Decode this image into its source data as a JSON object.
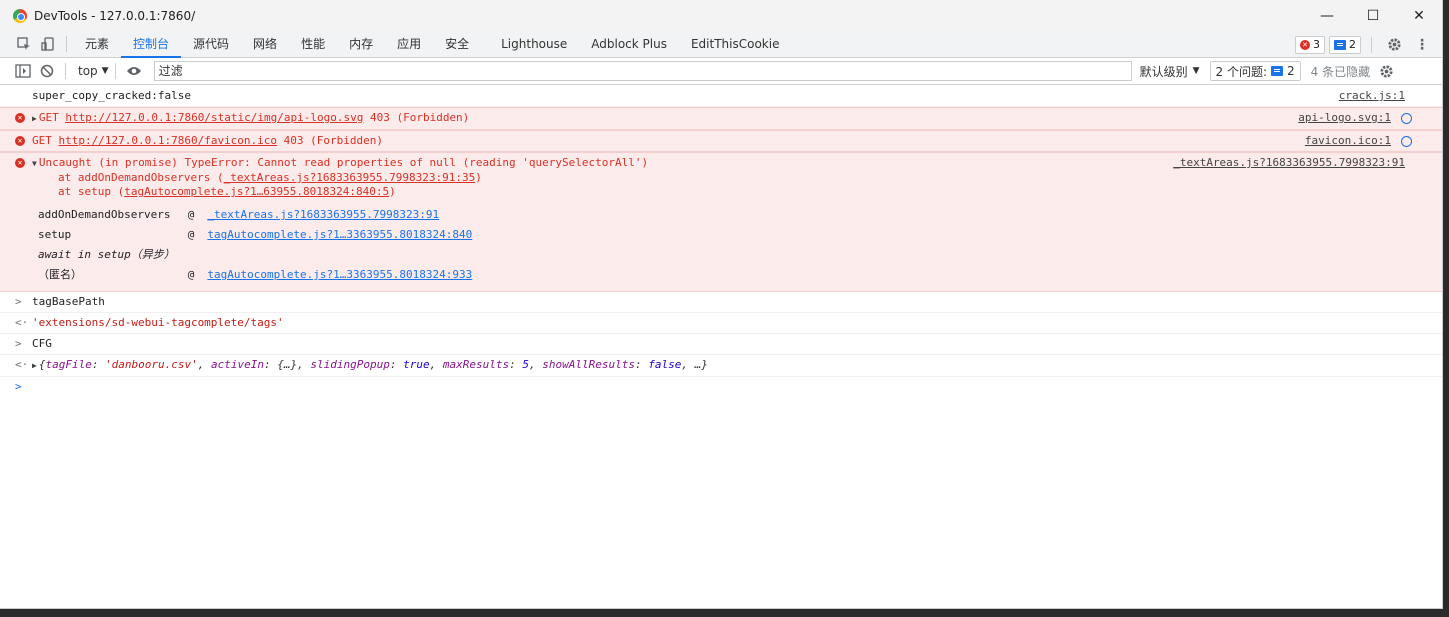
{
  "window": {
    "title": "DevTools - 127.0.0.1:7860/"
  },
  "window_controls": {
    "minimize": "—",
    "maximize": "☐",
    "close": "✕"
  },
  "tabs": [
    {
      "label": "元素"
    },
    {
      "label": "控制台"
    },
    {
      "label": "源代码"
    },
    {
      "label": "网络"
    },
    {
      "label": "性能"
    },
    {
      "label": "内存"
    },
    {
      "label": "应用"
    },
    {
      "label": "安全"
    },
    {
      "label": "Lighthouse"
    },
    {
      "label": "Adblock Plus"
    },
    {
      "label": "EditThisCookie"
    }
  ],
  "toolbar_right": {
    "errors": "3",
    "messages": "2"
  },
  "console_toolbar": {
    "context": "top",
    "filter_placeholder": "过滤",
    "level": "默认级别",
    "issues_label": "2 个问题:",
    "issues_count": "2",
    "hidden": "4 条已隐藏"
  },
  "logs": [
    {
      "text": "super_copy_cracked:false",
      "source": "crack.js:1"
    },
    {
      "method": "GET",
      "url": "http://127.0.0.1:7860/static/img/api-logo.svg",
      "status": "403 (Forbidden)",
      "source": "api-logo.svg:1"
    },
    {
      "method": "GET",
      "url": "http://127.0.0.1:7860/favicon.ico",
      "status": "403 (Forbidden)",
      "source": "favicon.ico:1"
    },
    {
      "text": "Uncaught (in promise) TypeError: Cannot read properties of null (reading 'querySelectorAll')",
      "source": "_textAreas.js?1683363955.7998323:91",
      "stack1_prefix": "at addOnDemandObservers (",
      "stack1_link": "_textAreas.js?1683363955.7998323:91:35",
      "stack1_suffix": ")",
      "stack2_prefix": "at setup (",
      "stack2_link": "tagAutocomplete.js?1…63955.8018324:840:5",
      "stack2_suffix": ")",
      "table": [
        {
          "fn": "addOnDemandObservers",
          "at": "@",
          "link": " _textAreas.js?1683363955.7998323:91"
        },
        {
          "fn": "setup",
          "at": "@",
          "link": "tagAutocomplete.js?1…3363955.8018324:840"
        },
        {
          "fn": "await in setup（异步）",
          "at": "",
          "link": ""
        },
        {
          "fn": "（匿名）",
          "at": "@",
          "link": "tagAutocomplete.js?1…3363955.8018324:933"
        }
      ]
    },
    {
      "input": "tagBasePath"
    },
    {
      "output": "'extensions/sd-webui-tagcomplete/tags'"
    },
    {
      "input": "CFG"
    },
    {
      "obj_open": "{",
      "k1": "tagFile",
      "v1": "'danbooru.csv'",
      "k2": "activeIn",
      "v2": "{…}",
      "k3": "slidingPopup",
      "v3": "true",
      "k4": "maxResults",
      "v4": "5",
      "k5": "showAllResults",
      "v5": "false",
      "tail": ", …}"
    }
  ]
}
